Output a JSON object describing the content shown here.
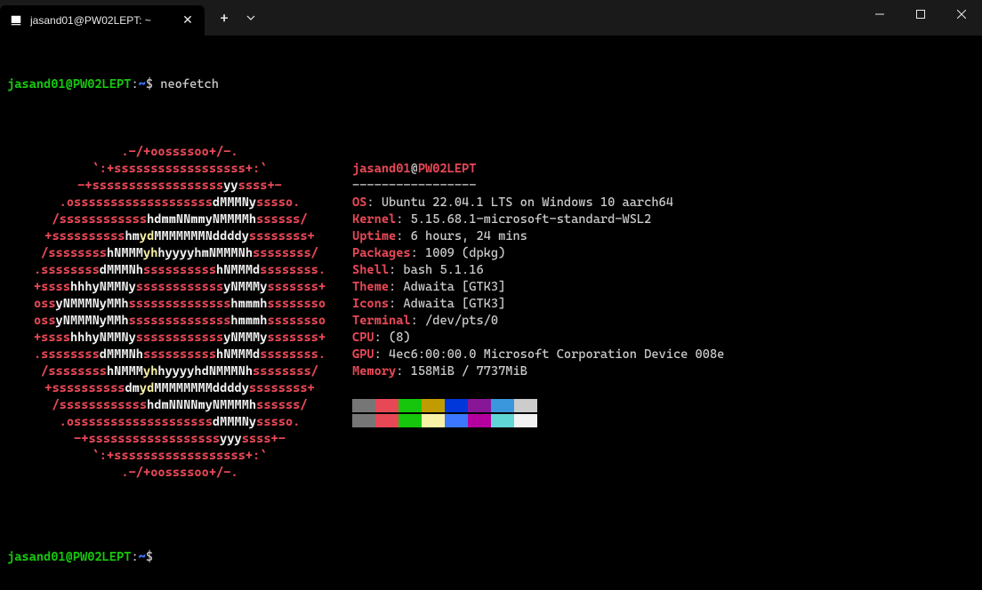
{
  "titlebar": {
    "tab_title": "jasand01@PW02LEPT: ~",
    "tab_close": "✕",
    "new_tab": "+",
    "dropdown": "⌄"
  },
  "prompt": {
    "user_host": "jasand01@PW02LEPT",
    "colon": ":",
    "path": "~",
    "dollar": "$",
    "command": "neofetch"
  },
  "info": {
    "user": "jasand01",
    "at": "@",
    "host": "PW02LEPT",
    "sep": "-----------------",
    "os_k": "OS",
    "os_v": ": Ubuntu 22.04.1 LTS on Windows 10 aarch64",
    "kernel_k": "Kernel",
    "kernel_v": ": 5.15.68.1-microsoft-standard-WSL2",
    "uptime_k": "Uptime",
    "uptime_v": ": 6 hours, 24 mins",
    "packages_k": "Packages",
    "packages_v": ": 1009 (dpkg)",
    "shell_k": "Shell",
    "shell_v": ": bash 5.1.16",
    "theme_k": "Theme",
    "theme_v": ": Adwaita [GTK3]",
    "icons_k": "Icons",
    "icons_v": ": Adwaita [GTK3]",
    "terminal_k": "Terminal",
    "terminal_v": ": /dev/pts/0",
    "cpu_k": "CPU",
    "cpu_v": ": (8)",
    "gpu_k": "GPU",
    "gpu_v": ": 4ec6:00:00.0 Microsoft Corporation Device 008e",
    "memory_k": "Memory",
    "memory_v": ": 158MiB / 7737MiB"
  },
  "ascii": [
    [
      [
        "r",
        ".-/+oossssoo+/-."
      ]
    ],
    [
      [
        "r",
        "`:+ssssssssssssssssss+:`"
      ]
    ],
    [
      [
        "r",
        "-+ssssssssssssssssss"
      ],
      [
        "w",
        "yy"
      ],
      [
        "r",
        "ssss+-"
      ]
    ],
    [
      [
        "r",
        ".osssssssssssssssssss"
      ],
      [
        "w",
        "dMMMNy"
      ],
      [
        "r",
        "sssso."
      ]
    ],
    [
      [
        "r",
        "/ssssssssssss"
      ],
      [
        "w",
        "hdmmNNmmyNMMMMh"
      ],
      [
        "r",
        "ssssss/"
      ]
    ],
    [
      [
        "r",
        "+ssssssssss"
      ],
      [
        "w",
        "hm"
      ],
      [
        "y",
        "yd"
      ],
      [
        "w",
        "MMMMMMMNddddy"
      ],
      [
        "r",
        "ssssssss+"
      ]
    ],
    [
      [
        "r",
        "/ssssssss"
      ],
      [
        "w",
        "hNMMM"
      ],
      [
        "y",
        "yh"
      ],
      [
        "w",
        "hyyyyhmNMMMNh"
      ],
      [
        "r",
        "ssssssss/"
      ]
    ],
    [
      [
        "r",
        ".ssssssss"
      ],
      [
        "w",
        "dMMMNh"
      ],
      [
        "r",
        "ssssssssss"
      ],
      [
        "w",
        "hNMMMd"
      ],
      [
        "r",
        "ssssssss."
      ]
    ],
    [
      [
        "r",
        "+ssss"
      ],
      [
        "w",
        "hhhyNMMNy"
      ],
      [
        "r",
        "ssssssssssss"
      ],
      [
        "w",
        "yNMMMy"
      ],
      [
        "r",
        "sssssss+"
      ]
    ],
    [
      [
        "r",
        "oss"
      ],
      [
        "w",
        "yNMMMNyMMh"
      ],
      [
        "r",
        "ssssssssssssss"
      ],
      [
        "w",
        "hmmmh"
      ],
      [
        "r",
        "ssssssso"
      ]
    ],
    [
      [
        "r",
        "oss"
      ],
      [
        "w",
        "yNMMMNyMMh"
      ],
      [
        "r",
        "ssssssssssssss"
      ],
      [
        "w",
        "hmmmh"
      ],
      [
        "r",
        "ssssssso"
      ]
    ],
    [
      [
        "r",
        "+ssss"
      ],
      [
        "w",
        "hhhyNMMNy"
      ],
      [
        "r",
        "ssssssssssss"
      ],
      [
        "w",
        "yNMMMy"
      ],
      [
        "r",
        "sssssss+"
      ]
    ],
    [
      [
        "r",
        ".ssssssss"
      ],
      [
        "w",
        "dMMMNh"
      ],
      [
        "r",
        "ssssssssss"
      ],
      [
        "w",
        "hNMMMd"
      ],
      [
        "r",
        "ssssssss."
      ]
    ],
    [
      [
        "r",
        "/ssssssss"
      ],
      [
        "w",
        "hNMMM"
      ],
      [
        "y",
        "yh"
      ],
      [
        "w",
        "hyyyyhdNMMMNh"
      ],
      [
        "r",
        "ssssssss/"
      ]
    ],
    [
      [
        "r",
        "+ssssssssss"
      ],
      [
        "w",
        "dm"
      ],
      [
        "y",
        "yd"
      ],
      [
        "w",
        "MMMMMMMMddddy"
      ],
      [
        "r",
        "ssssssss+"
      ]
    ],
    [
      [
        "r",
        "/ssssssssssss"
      ],
      [
        "w",
        "hdmNNNNmyNMMMMh"
      ],
      [
        "r",
        "ssssss/"
      ]
    ],
    [
      [
        "r",
        ".osssssssssssssssssss"
      ],
      [
        "w",
        "dMMMNy"
      ],
      [
        "r",
        "sssso."
      ]
    ],
    [
      [
        "r",
        "-+ssssssssssssssssss"
      ],
      [
        "w",
        "yyy"
      ],
      [
        "r",
        "ssss+-"
      ]
    ],
    [
      [
        "r",
        "`:+ssssssssssssssssss+:`"
      ]
    ],
    [
      [
        "r",
        ".-/+oossssoo+/-."
      ]
    ]
  ],
  "colors_row1": [
    "#767676",
    "#e74856",
    "#16c60c",
    "#c19c00",
    "#0037da",
    "#881798",
    "#3a96dd",
    "#cccccc"
  ],
  "colors_row2": [
    "#767676",
    "#e74856",
    "#16c60c",
    "#f9f1a5",
    "#3b78ff",
    "#b4009e",
    "#61d6d6",
    "#f2f2f2"
  ]
}
